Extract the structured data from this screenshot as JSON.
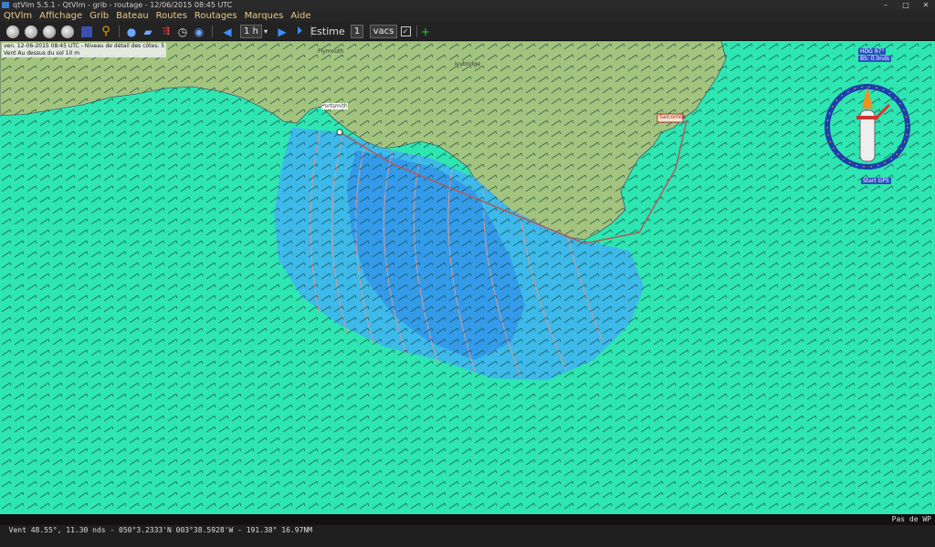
{
  "window": {
    "title": "qtVlm 5.5.1 - QtVlm - grib - routage - 12/06/2015 08:45 UTC"
  },
  "menu": [
    "QtVlm",
    "Affichage",
    "Grib",
    "Bateau",
    "Routes",
    "Routages",
    "Marques",
    "Aide"
  ],
  "toolbar": {
    "step": "1 h",
    "estime_label": "Estime",
    "estime_value": "1",
    "estime_unit": "vacs",
    "icons": [
      "zoom-in-icon",
      "zoom-out-icon",
      "zoom-fit-icon",
      "zoom-boat-icon",
      "select-icon",
      "magnifier-icon",
      "open-icon",
      "save-icon",
      "barb-icon",
      "clock-icon",
      "gps-icon",
      "prev-icon",
      "next-icon",
      "play-icon",
      "add-icon"
    ]
  },
  "map": {
    "info_line1": "ven. 12-06-2015 08:45 UTC - Niveau de détail des côtes: 5",
    "info_line2": "Vent Au dessus du sol 10 m",
    "places": [
      "Plymouth",
      "Ivybridge",
      "Salcombe"
    ],
    "boat_label": "Portsmith",
    "compass": {
      "hdg": "HDG 97°",
      "speed": "BS: 0.0nds",
      "start": "Start GPS"
    },
    "colors": {
      "land": "#a3c47f",
      "sea": "#2ee6b2",
      "isochrone": "#d69a96",
      "route": "#b05a5a"
    }
  },
  "status": {
    "text": "Vent 48.55°, 11.30 nds - 050°3.2333'N 003°38.5928'W - 191.38° 16.97NM",
    "right": "Pas de WP"
  }
}
